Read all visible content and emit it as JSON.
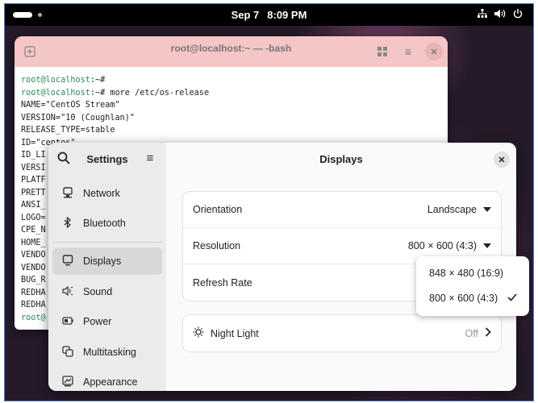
{
  "topbar": {
    "date": "Sep 7",
    "time": "8:09 PM"
  },
  "terminal": {
    "title": "root@localhost:~ — -bash",
    "lines": [
      {
        "prompt": "root@localhost",
        "rest": ":~#"
      },
      {
        "prompt": "root@localhost",
        "rest": ":~# more /etc/os-release"
      },
      {
        "prompt": "",
        "rest": "NAME=\"CentOS Stream\""
      },
      {
        "prompt": "",
        "rest": "VERSION=\"10 (Coughlan)\""
      },
      {
        "prompt": "",
        "rest": "RELEASE_TYPE=stable"
      },
      {
        "prompt": "",
        "rest": "ID=\"centos\""
      },
      {
        "prompt": "",
        "rest": "ID_LI"
      },
      {
        "prompt": "",
        "rest": "VERSI"
      },
      {
        "prompt": "",
        "rest": "PLATF"
      },
      {
        "prompt": "",
        "rest": "PRETT"
      },
      {
        "prompt": "",
        "rest": "ANSI_"
      },
      {
        "prompt": "",
        "rest": "LOGO="
      },
      {
        "prompt": "",
        "rest": "CPE_N"
      },
      {
        "prompt": "",
        "rest": "HOME_"
      },
      {
        "prompt": "",
        "rest": "VENDO"
      },
      {
        "prompt": "",
        "rest": "VENDO"
      },
      {
        "prompt": "",
        "rest": "BUG_R"
      },
      {
        "prompt": "",
        "rest": "REDHA"
      },
      {
        "prompt": "",
        "rest": "REDHA"
      },
      {
        "prompt": "root@",
        "rest": ""
      }
    ]
  },
  "settings": {
    "sidebar_title": "Settings",
    "items": [
      {
        "label": "Network",
        "icon": "network-icon"
      },
      {
        "label": "Bluetooth",
        "icon": "bluetooth-icon"
      },
      {
        "label": "Displays",
        "icon": "display-icon"
      },
      {
        "label": "Sound",
        "icon": "sound-icon"
      },
      {
        "label": "Power",
        "icon": "power-icon"
      },
      {
        "label": "Multitasking",
        "icon": "multitasking-icon"
      },
      {
        "label": "Appearance",
        "icon": "appearance-icon"
      }
    ],
    "page_title": "Displays",
    "orientation": {
      "label": "Orientation",
      "value": "Landscape"
    },
    "resolution": {
      "label": "Resolution",
      "value": "800 × 600 (4:3)"
    },
    "refresh": {
      "label": "Refresh Rate"
    },
    "night_light": {
      "label": "Night Light",
      "value": "Off"
    },
    "resolution_options": [
      {
        "label": "848 × 480 (16:9)"
      },
      {
        "label": "800 × 600 (4:3)"
      }
    ]
  }
}
